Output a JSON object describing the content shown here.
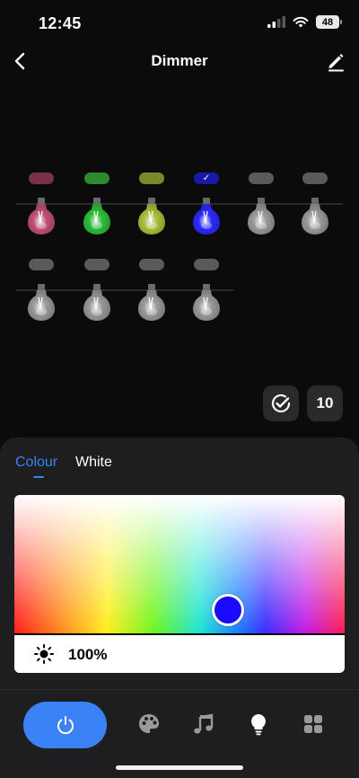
{
  "status_bar": {
    "time": "12:45",
    "battery": "48"
  },
  "nav": {
    "title": "Dimmer"
  },
  "bulbs_row1": [
    {
      "color": "#c2507a",
      "tag_color": "#7a3046",
      "selected": false
    },
    {
      "color": "#2dbf3a",
      "tag_color": "#2f8a2f",
      "selected": false
    },
    {
      "color": "#a8c23a",
      "tag_color": "#7a8a2a",
      "selected": false
    },
    {
      "color": "#2a2aff",
      "tag_color": "#1a1aa8",
      "selected": true,
      "check": "✓"
    },
    {
      "color": "#9a9a9a",
      "tag_color": "#5a5a5a",
      "selected": false
    },
    {
      "color": "#9a9a9a",
      "tag_color": "#5a5a5a",
      "selected": false
    }
  ],
  "bulbs_row2": [
    {
      "color": "#9a9a9a",
      "tag_color": "#5a5a5a",
      "selected": false
    },
    {
      "color": "#9a9a9a",
      "tag_color": "#5a5a5a",
      "selected": false
    },
    {
      "color": "#9a9a9a",
      "tag_color": "#5a5a5a",
      "selected": false
    },
    {
      "color": "#9a9a9a",
      "tag_color": "#5a5a5a",
      "selected": false
    }
  ],
  "actions": {
    "count": "10"
  },
  "panel": {
    "tabs": [
      {
        "label": "Colour",
        "active": true
      },
      {
        "label": "White",
        "active": false
      }
    ],
    "selected_color": "#1a0aff",
    "brightness": "100%"
  },
  "accent_color": "#3b82f6",
  "toolbar": {
    "icons": [
      "power-icon",
      "palette-icon",
      "music-icon",
      "bulb-icon",
      "scenes-icon"
    ],
    "active": "bulb-icon"
  }
}
